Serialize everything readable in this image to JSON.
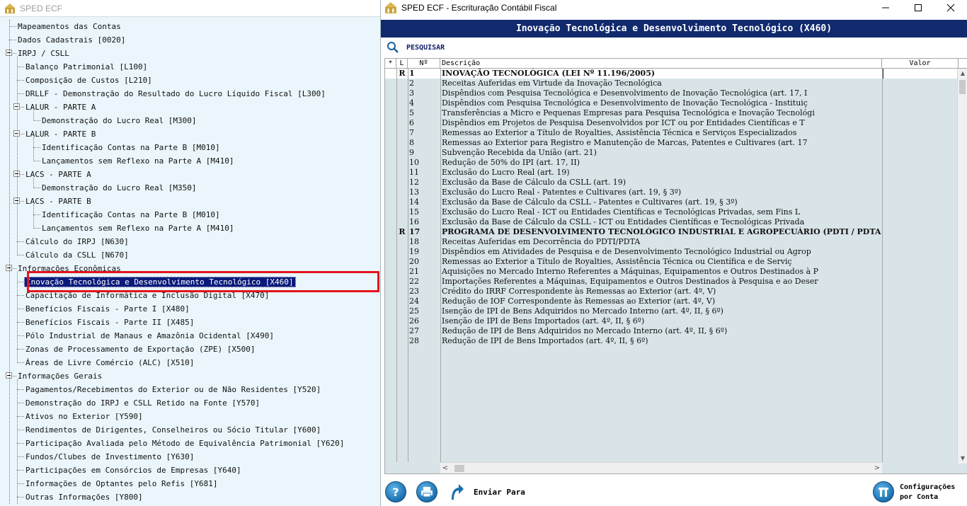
{
  "left_window": {
    "title": "SPED ECF",
    "tree": [
      {
        "label": "Mapeamentos das Contas",
        "level": 0,
        "expander": false
      },
      {
        "label": "Dados Cadastrais [0020]",
        "level": 0,
        "expander": false
      },
      {
        "label": "IRPJ / CSLL",
        "level": 0,
        "expander": true
      },
      {
        "label": "Balanço Patrimonial [L100]",
        "level": 1,
        "expander": false
      },
      {
        "label": "Composição de Custos [L210]",
        "level": 1,
        "expander": false
      },
      {
        "label": "DRLLF - Demonstração do Resultado do Lucro Líquido Fiscal [L300]",
        "level": 1,
        "expander": false
      },
      {
        "label": "LALUR - PARTE A",
        "level": 1,
        "expander": true
      },
      {
        "label": "Demonstração do Lucro Real [M300]",
        "level": 2,
        "expander": false
      },
      {
        "label": "LALUR - PARTE B",
        "level": 1,
        "expander": true
      },
      {
        "label": "Identificação Contas na Parte B [M010]",
        "level": 2,
        "expander": false
      },
      {
        "label": "Lançamentos sem Reflexo na Parte A [M410]",
        "level": 2,
        "expander": false
      },
      {
        "label": "LACS - PARTE A",
        "level": 1,
        "expander": true
      },
      {
        "label": "Demonstração do Lucro Real [M350]",
        "level": 2,
        "expander": false
      },
      {
        "label": "LACS - PARTE B",
        "level": 1,
        "expander": true
      },
      {
        "label": "Identificação Contas na Parte B [M010]",
        "level": 2,
        "expander": false
      },
      {
        "label": "Lançamentos sem Reflexo na Parte A [M410]",
        "level": 2,
        "expander": false
      },
      {
        "label": "Cálculo do IRPJ [N630]",
        "level": 1,
        "expander": false
      },
      {
        "label": "Cálculo da CSLL [N670]",
        "level": 1,
        "expander": false
      },
      {
        "label": "Informações Econômicas",
        "level": 0,
        "expander": true
      },
      {
        "label": "Inovação Tecnológica e Desenvolvimento Tecnológico [X460]",
        "level": 1,
        "expander": false,
        "selected": true
      },
      {
        "label": "Capacitação de Informática e Inclusão Digital [X470]",
        "level": 1,
        "expander": false
      },
      {
        "label": "Benefícios Fiscais - Parte I [X480]",
        "level": 1,
        "expander": false
      },
      {
        "label": "Benefícios Fiscais - Parte II [X485]",
        "level": 1,
        "expander": false
      },
      {
        "label": "Pólo Industrial de Manaus e Amazônia Ocidental [X490]",
        "level": 1,
        "expander": false
      },
      {
        "label": "Zonas de Processamento de Exportação (ZPE) [X500]",
        "level": 1,
        "expander": false
      },
      {
        "label": "Áreas de Livre Comércio (ALC) [X510]",
        "level": 1,
        "expander": false
      },
      {
        "label": "Informações Gerais",
        "level": 0,
        "expander": true
      },
      {
        "label": "Pagamentos/Recebimentos do Exterior ou de Não Residentes [Y520]",
        "level": 1,
        "expander": false
      },
      {
        "label": "Demonstração do IRPJ e CSLL Retido na Fonte [Y570]",
        "level": 1,
        "expander": false
      },
      {
        "label": "Ativos no Exterior [Y590]",
        "level": 1,
        "expander": false
      },
      {
        "label": "Rendimentos de Dirigentes, Conselheiros ou Sócio Titular [Y600]",
        "level": 1,
        "expander": false
      },
      {
        "label": "Participação Avaliada pelo Método de Equivalência Patrimonial [Y620]",
        "level": 1,
        "expander": false
      },
      {
        "label": "Fundos/Clubes de Investimento [Y630]",
        "level": 1,
        "expander": false
      },
      {
        "label": "Participações em Consórcios de Empresas [Y640]",
        "level": 1,
        "expander": false
      },
      {
        "label": "Informações de Optantes pelo Refis [Y681]",
        "level": 1,
        "expander": false
      },
      {
        "label": "Outras Informações [Y800]",
        "level": 1,
        "expander": false
      }
    ]
  },
  "right_window": {
    "title": "SPED ECF  -  Escrituração Contábil Fiscal",
    "header": "Inovação Tecnológica e Desenvolvimento Tecnológico (X460)",
    "search_label": "PESQUISAR",
    "columns": {
      "star": "*",
      "l": "L",
      "num": "Nº",
      "desc": "Descrição",
      "valor": "Valor"
    },
    "rows": [
      {
        "l": "R",
        "num": "1",
        "desc": "INOVAÇÃO TECNOLÓGICA (LEI Nº 11.196/2005)",
        "bold": true
      },
      {
        "l": "",
        "num": "2",
        "desc": "Receitas Auferidas em Virtude da Inovação Tecnológica"
      },
      {
        "l": "",
        "num": "3",
        "desc": "Dispêndios com Pesquisa Tecnológica e Desenvolvimento de Inovação Tecnológica (art. 17, I"
      },
      {
        "l": "",
        "num": "4",
        "desc": "Dispêndios com Pesquisa Tecnológica e Desenvolvimento de Inovação Tecnológica - Instituiç"
      },
      {
        "l": "",
        "num": "5",
        "desc": "Transferências a Micro e Pequenas Empresas para Pesquisa Tecnológica e Inovação Tecnológi"
      },
      {
        "l": "",
        "num": "6",
        "desc": "Dispêndios em Projetos de Pesquisa Desenvolvidos por ICT ou por Entidades Científicas e T"
      },
      {
        "l": "",
        "num": "7",
        "desc": "Remessas ao Exterior a Título de Royalties, Assistência Técnica e Serviços Especializados"
      },
      {
        "l": "",
        "num": "8",
        "desc": "Remessas ao Exterior para Registro e Manutenção de Marcas, Patentes e Cultivares (art. 17"
      },
      {
        "l": "",
        "num": "9",
        "desc": "Subvenção Recebida da União (art. 21)"
      },
      {
        "l": "",
        "num": "10",
        "desc": "Redução de 50% do IPI (art. 17, II)"
      },
      {
        "l": "",
        "num": "11",
        "desc": "Exclusão do Lucro Real (art. 19)"
      },
      {
        "l": "",
        "num": "12",
        "desc": "Exclusão da Base de Cálculo da CSLL (art. 19)"
      },
      {
        "l": "",
        "num": "13",
        "desc": "Exclusão do Lucro Real - Patentes e Cultivares (art. 19, § 3º)"
      },
      {
        "l": "",
        "num": "14",
        "desc": "Exclusão da Base de Cálculo da CSLL - Patentes e Cultivares (art. 19, § 3º)"
      },
      {
        "l": "",
        "num": "15",
        "desc": "Exclusão do Lucro Real - ICT ou Entidades Científicas e Tecnológicas Privadas, sem Fins L"
      },
      {
        "l": "",
        "num": "16",
        "desc": "Exclusão da Base de Cálculo da CSLL - ICT ou Entidades Científicas e Tecnológicas Privada"
      },
      {
        "l": "R",
        "num": "17",
        "desc": "PROGRAMA DE DESENVOLVIMENTO TECNOLÓGICO INDUSTRIAL E AGROPECUÁRIO (PDTI / PDTA - LEI Nº 8",
        "bold": true
      },
      {
        "l": "",
        "num": "18",
        "desc": "Receitas Auferidas em Decorrência do PDTI/PDTA"
      },
      {
        "l": "",
        "num": "19",
        "desc": "Dispêndios em Atividades de Pesquisa e de Desenvolvimento Tecnológico Industrial ou Agrop"
      },
      {
        "l": "",
        "num": "20",
        "desc": "Remessas ao Exterior a Título de Royalties, Assistência Técnica ou Científica e de Serviç"
      },
      {
        "l": "",
        "num": "21",
        "desc": "Aquisições no Mercado Interno Referentes a Máquinas, Equipamentos e Outros Destinados à P"
      },
      {
        "l": "",
        "num": "22",
        "desc": "Importações Referentes a Máquinas, Equipamentos e Outros Destinados à Pesquisa e ao Deser"
      },
      {
        "l": "",
        "num": "23",
        "desc": "Crédito do IRRF Correspondente às Remessas ao Exterior (art. 4º, V)"
      },
      {
        "l": "",
        "num": "24",
        "desc": "Redução de IOF Correspondente às Remessas ao Exterior (art. 4º, V)"
      },
      {
        "l": "",
        "num": "25",
        "desc": "Isenção de IPI de Bens Adquiridos no Mercado Interno (art. 4º, II, § 6º)"
      },
      {
        "l": "",
        "num": "26",
        "desc": "Isenção de IPI de Bens Importados (art. 4º, II, § 6º)"
      },
      {
        "l": "",
        "num": "27",
        "desc": "Redução de IPI de Bens Adquiridos no Mercado Interno (art. 4º, II, § 6º)"
      },
      {
        "l": "",
        "num": "28",
        "desc": "Redução de IPI de Bens Importados (art. 4º, II, § 6º)"
      }
    ],
    "toolbar": {
      "help": "?",
      "send_label": "Enviar Para",
      "config_line1": "Configurações",
      "config_line2": "por Conta"
    }
  },
  "colors": {
    "header_bg": "#112a6e",
    "selected_bg": "#0a1a7a",
    "highlight_border": "#e3141c",
    "tree_bg": "#eaf6fb",
    "grid_bg": "#d8e4e8"
  }
}
